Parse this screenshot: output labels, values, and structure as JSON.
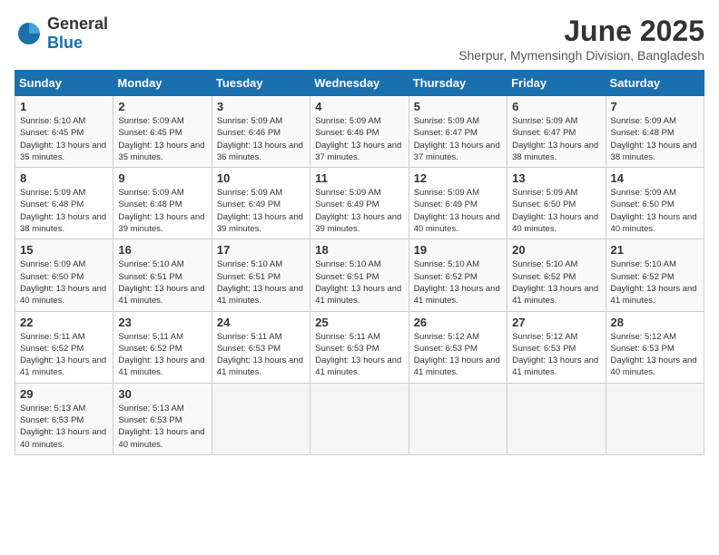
{
  "header": {
    "logo_general": "General",
    "logo_blue": "Blue",
    "month_year": "June 2025",
    "location": "Sherpur, Mymensingh Division, Bangladesh"
  },
  "calendar": {
    "weekdays": [
      "Sunday",
      "Monday",
      "Tuesday",
      "Wednesday",
      "Thursday",
      "Friday",
      "Saturday"
    ],
    "weeks": [
      [
        {
          "day": "",
          "info": ""
        },
        {
          "day": "2",
          "info": "Sunrise: 5:09 AM\nSunset: 6:45 PM\nDaylight: 13 hours and 35 minutes."
        },
        {
          "day": "3",
          "info": "Sunrise: 5:09 AM\nSunset: 6:46 PM\nDaylight: 13 hours and 36 minutes."
        },
        {
          "day": "4",
          "info": "Sunrise: 5:09 AM\nSunset: 6:46 PM\nDaylight: 13 hours and 37 minutes."
        },
        {
          "day": "5",
          "info": "Sunrise: 5:09 AM\nSunset: 6:47 PM\nDaylight: 13 hours and 37 minutes."
        },
        {
          "day": "6",
          "info": "Sunrise: 5:09 AM\nSunset: 6:47 PM\nDaylight: 13 hours and 38 minutes."
        },
        {
          "day": "7",
          "info": "Sunrise: 5:09 AM\nSunset: 6:48 PM\nDaylight: 13 hours and 38 minutes."
        }
      ],
      [
        {
          "day": "8",
          "info": "Sunrise: 5:09 AM\nSunset: 6:48 PM\nDaylight: 13 hours and 38 minutes."
        },
        {
          "day": "9",
          "info": "Sunrise: 5:09 AM\nSunset: 6:48 PM\nDaylight: 13 hours and 39 minutes."
        },
        {
          "day": "10",
          "info": "Sunrise: 5:09 AM\nSunset: 6:49 PM\nDaylight: 13 hours and 39 minutes."
        },
        {
          "day": "11",
          "info": "Sunrise: 5:09 AM\nSunset: 6:49 PM\nDaylight: 13 hours and 39 minutes."
        },
        {
          "day": "12",
          "info": "Sunrise: 5:09 AM\nSunset: 6:49 PM\nDaylight: 13 hours and 40 minutes."
        },
        {
          "day": "13",
          "info": "Sunrise: 5:09 AM\nSunset: 6:50 PM\nDaylight: 13 hours and 40 minutes."
        },
        {
          "day": "14",
          "info": "Sunrise: 5:09 AM\nSunset: 6:50 PM\nDaylight: 13 hours and 40 minutes."
        }
      ],
      [
        {
          "day": "15",
          "info": "Sunrise: 5:09 AM\nSunset: 6:50 PM\nDaylight: 13 hours and 40 minutes."
        },
        {
          "day": "16",
          "info": "Sunrise: 5:10 AM\nSunset: 6:51 PM\nDaylight: 13 hours and 41 minutes."
        },
        {
          "day": "17",
          "info": "Sunrise: 5:10 AM\nSunset: 6:51 PM\nDaylight: 13 hours and 41 minutes."
        },
        {
          "day": "18",
          "info": "Sunrise: 5:10 AM\nSunset: 6:51 PM\nDaylight: 13 hours and 41 minutes."
        },
        {
          "day": "19",
          "info": "Sunrise: 5:10 AM\nSunset: 6:52 PM\nDaylight: 13 hours and 41 minutes."
        },
        {
          "day": "20",
          "info": "Sunrise: 5:10 AM\nSunset: 6:52 PM\nDaylight: 13 hours and 41 minutes."
        },
        {
          "day": "21",
          "info": "Sunrise: 5:10 AM\nSunset: 6:52 PM\nDaylight: 13 hours and 41 minutes."
        }
      ],
      [
        {
          "day": "22",
          "info": "Sunrise: 5:11 AM\nSunset: 6:52 PM\nDaylight: 13 hours and 41 minutes."
        },
        {
          "day": "23",
          "info": "Sunrise: 5:11 AM\nSunset: 6:52 PM\nDaylight: 13 hours and 41 minutes."
        },
        {
          "day": "24",
          "info": "Sunrise: 5:11 AM\nSunset: 6:53 PM\nDaylight: 13 hours and 41 minutes."
        },
        {
          "day": "25",
          "info": "Sunrise: 5:11 AM\nSunset: 6:53 PM\nDaylight: 13 hours and 41 minutes."
        },
        {
          "day": "26",
          "info": "Sunrise: 5:12 AM\nSunset: 6:53 PM\nDaylight: 13 hours and 41 minutes."
        },
        {
          "day": "27",
          "info": "Sunrise: 5:12 AM\nSunset: 6:53 PM\nDaylight: 13 hours and 41 minutes."
        },
        {
          "day": "28",
          "info": "Sunrise: 5:12 AM\nSunset: 6:53 PM\nDaylight: 13 hours and 40 minutes."
        }
      ],
      [
        {
          "day": "29",
          "info": "Sunrise: 5:13 AM\nSunset: 6:53 PM\nDaylight: 13 hours and 40 minutes."
        },
        {
          "day": "30",
          "info": "Sunrise: 5:13 AM\nSunset: 6:53 PM\nDaylight: 13 hours and 40 minutes."
        },
        {
          "day": "",
          "info": ""
        },
        {
          "day": "",
          "info": ""
        },
        {
          "day": "",
          "info": ""
        },
        {
          "day": "",
          "info": ""
        },
        {
          "day": "",
          "info": ""
        }
      ]
    ],
    "week1_sun": {
      "day": "1",
      "info": "Sunrise: 5:10 AM\nSunset: 6:45 PM\nDaylight: 13 hours and 35 minutes."
    }
  }
}
